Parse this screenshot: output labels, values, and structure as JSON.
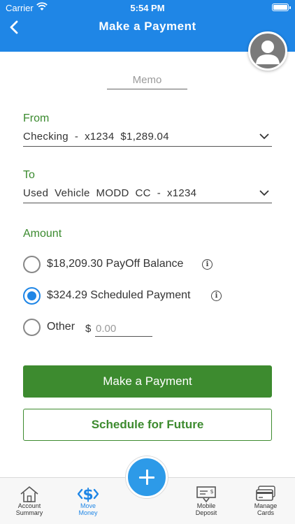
{
  "status_bar": {
    "carrier": "Carrier",
    "time": "5:54 PM"
  },
  "header": {
    "title": "Make a Payment",
    "back_icon": "chevron-left-icon",
    "avatar_icon": "user-avatar-icon"
  },
  "memo": {
    "placeholder": "Memo"
  },
  "from": {
    "label": "From",
    "value": "Checking  -  x1234  $1,289.04"
  },
  "to": {
    "label": "To",
    "value": "Used  Vehicle  MODD  CC  -  x1234"
  },
  "amount": {
    "label": "Amount",
    "options": [
      {
        "label": "$18,209.30 PayOff Balance",
        "selected": false,
        "has_info": true
      },
      {
        "label": "$324.29 Scheduled Payment",
        "selected": true,
        "has_info": true
      },
      {
        "label": "Other",
        "selected": false,
        "has_info": false
      }
    ],
    "other_currency": "$",
    "other_placeholder": "0.00"
  },
  "buttons": {
    "primary": "Make a Payment",
    "secondary": "Schedule for Future"
  },
  "tabs": [
    {
      "label_line1": "Account",
      "label_line2": "Summary",
      "icon": "home-icon",
      "active": false
    },
    {
      "label_line1": "Move",
      "label_line2": "Money",
      "icon": "dollar-transfer-icon",
      "active": true
    },
    {
      "label_line1": "Mobile",
      "label_line2": "Deposit",
      "icon": "check-deposit-icon",
      "active": false
    },
    {
      "label_line1": "Manage",
      "label_line2": "Cards",
      "icon": "credit-card-icon",
      "active": false
    }
  ],
  "colors": {
    "header_blue": "#1f86e6",
    "accent_green": "#3d8b2f",
    "label_green": "#3a8a2e"
  }
}
